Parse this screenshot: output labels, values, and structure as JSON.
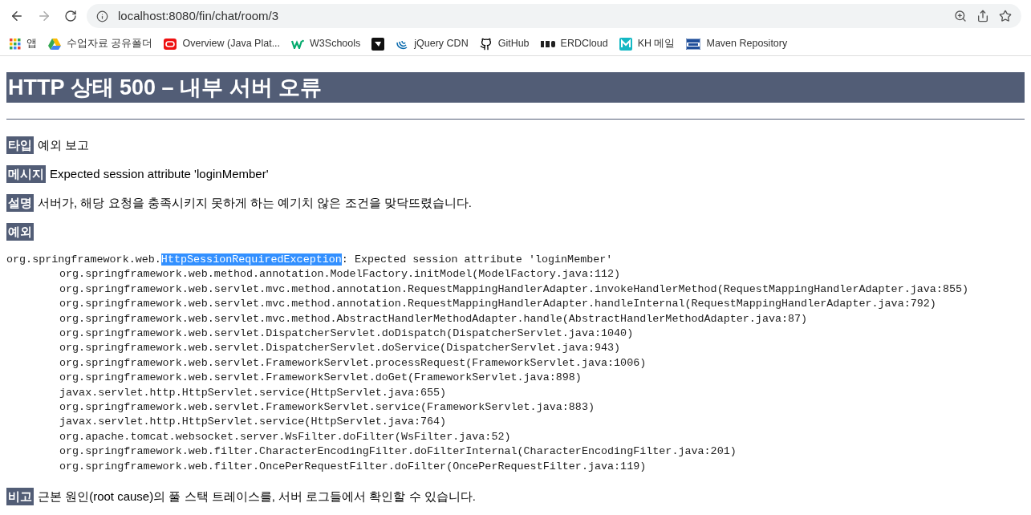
{
  "browser": {
    "url": "localhost:8080/fin/chat/room/3",
    "bookmarks": [
      {
        "label": "앱",
        "kind": "apps"
      },
      {
        "label": "수업자료 공유폴더",
        "kind": "drive"
      },
      {
        "label": "Overview (Java Plat...",
        "kind": "oracle"
      },
      {
        "label": "W3Schools",
        "kind": "w3"
      },
      {
        "kind": "square"
      },
      {
        "label": "jQuery CDN",
        "kind": "jquery"
      },
      {
        "label": "GitHub",
        "kind": "github"
      },
      {
        "label": "ERDCloud",
        "kind": "erd"
      },
      {
        "label": "KH 메일",
        "kind": "m"
      },
      {
        "label": "Maven Repository",
        "kind": "mvn"
      }
    ]
  },
  "page": {
    "title": "HTTP 상태 500 – 내부 서버 오류",
    "fields": [
      {
        "label": "타입",
        "text": "예외 보고"
      },
      {
        "label": "메시지",
        "text": "Expected session attribute 'loginMember'"
      },
      {
        "label": "설명",
        "text": "서버가, 해당 요청을 충족시키지 못하게 하는 예기치 않은 조건을 맞닥뜨렸습니다."
      },
      {
        "label": "예외"
      }
    ],
    "trace": {
      "head": [
        {
          "text": "org.springframework.web.",
          "selected": false
        },
        {
          "text": "HttpSessionRequiredException",
          "selected": true
        },
        {
          "text": ": Expected session attribute 'loginMember'",
          "selected": false
        }
      ],
      "frames": [
        "org.springframework.web.method.annotation.ModelFactory.initModel(ModelFactory.java:112)",
        "org.springframework.web.servlet.mvc.method.annotation.RequestMappingHandlerAdapter.invokeHandlerMethod(RequestMappingHandlerAdapter.java:855)",
        "org.springframework.web.servlet.mvc.method.annotation.RequestMappingHandlerAdapter.handleInternal(RequestMappingHandlerAdapter.java:792)",
        "org.springframework.web.servlet.mvc.method.AbstractHandlerMethodAdapter.handle(AbstractHandlerMethodAdapter.java:87)",
        "org.springframework.web.servlet.DispatcherServlet.doDispatch(DispatcherServlet.java:1040)",
        "org.springframework.web.servlet.DispatcherServlet.doService(DispatcherServlet.java:943)",
        "org.springframework.web.servlet.FrameworkServlet.processRequest(FrameworkServlet.java:1006)",
        "org.springframework.web.servlet.FrameworkServlet.doGet(FrameworkServlet.java:898)",
        "javax.servlet.http.HttpServlet.service(HttpServlet.java:655)",
        "org.springframework.web.servlet.FrameworkServlet.service(FrameworkServlet.java:883)",
        "javax.servlet.http.HttpServlet.service(HttpServlet.java:764)",
        "org.apache.tomcat.websocket.server.WsFilter.doFilter(WsFilter.java:52)",
        "org.springframework.web.filter.CharacterEncodingFilter.doFilterInternal(CharacterEncodingFilter.java:201)",
        "org.springframework.web.filter.OncePerRequestFilter.doFilter(OncePerRequestFilter.java:119)"
      ]
    },
    "note": {
      "label": "비고",
      "text": "근본 원인(root cause)의 풀 스택 트레이스를, 서버 로그들에서 확인할 수 있습니다."
    }
  }
}
